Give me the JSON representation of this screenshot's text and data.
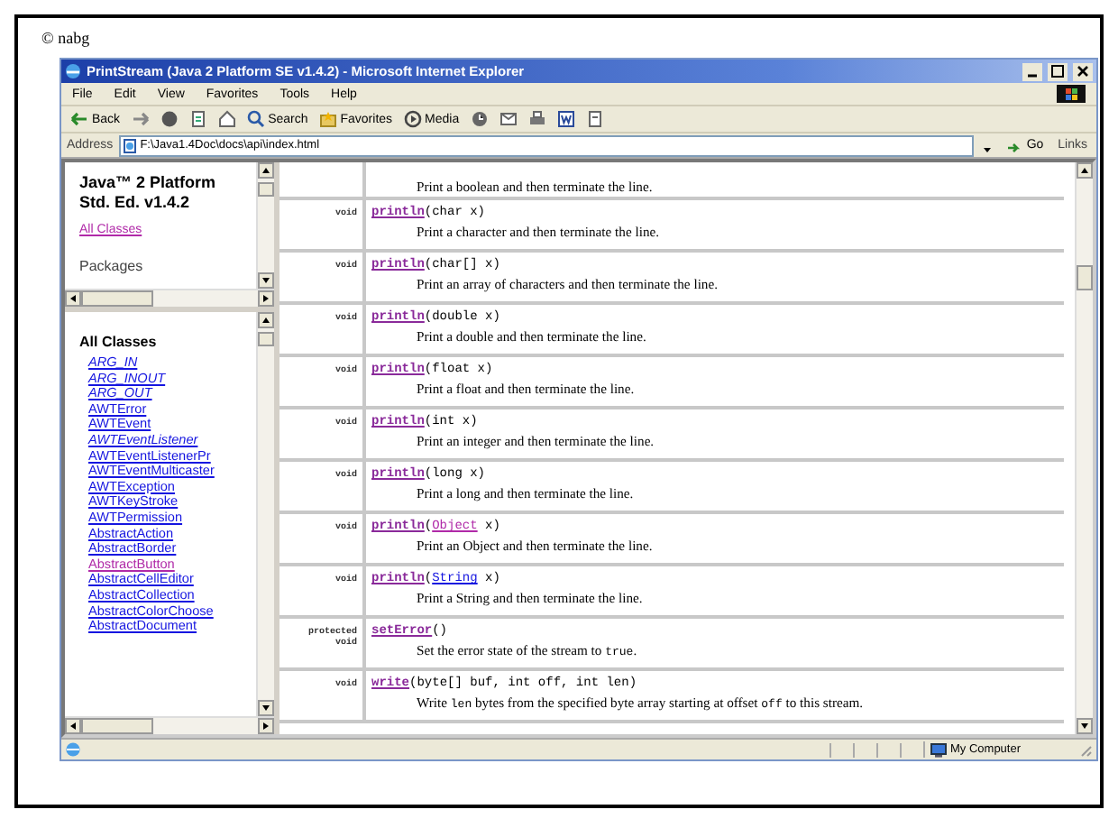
{
  "credit": "© nabg",
  "window": {
    "title": "PrintStream (Java 2 Platform SE v1.4.2) - Microsoft Internet Explorer"
  },
  "menu": [
    "File",
    "Edit",
    "View",
    "Favorites",
    "Tools",
    "Help"
  ],
  "toolbar": [
    {
      "kind": "back",
      "label": "Back"
    },
    {
      "kind": "forward"
    },
    {
      "kind": "stop"
    },
    {
      "kind": "refresh"
    },
    {
      "kind": "home"
    },
    {
      "kind": "search",
      "label": "Search"
    },
    {
      "kind": "favorites",
      "label": "Favorites"
    },
    {
      "kind": "media",
      "label": "Media"
    },
    {
      "kind": "history"
    },
    {
      "kind": "mail"
    },
    {
      "kind": "print"
    },
    {
      "kind": "edit"
    },
    {
      "kind": "discuss"
    }
  ],
  "address": {
    "label": "Address",
    "value": "F:\\Java1.4Doc\\docs\\api\\index.html",
    "go": "Go",
    "links": "Links"
  },
  "packages_frame": {
    "title_lines": [
      "Java™ 2 Platform",
      "Std. Ed. v1.4.2"
    ],
    "link": {
      "text": "All Classes",
      "visited": true
    },
    "heading": "Packages"
  },
  "classes_frame": {
    "heading": "All Classes",
    "classes": [
      {
        "name": "ARG_IN",
        "italic": true,
        "visited": false
      },
      {
        "name": "ARG_INOUT",
        "italic": true,
        "visited": false
      },
      {
        "name": "ARG_OUT",
        "italic": true,
        "visited": false
      },
      {
        "name": "AWTError",
        "italic": false,
        "visited": false
      },
      {
        "name": "AWTEvent",
        "italic": false,
        "visited": false
      },
      {
        "name": "AWTEventListener",
        "italic": true,
        "visited": false
      },
      {
        "name": "AWTEventListenerPr",
        "italic": false,
        "visited": false
      },
      {
        "name": "AWTEventMulticaster",
        "italic": false,
        "visited": false
      },
      {
        "name": "AWTException",
        "italic": false,
        "visited": false
      },
      {
        "name": "AWTKeyStroke",
        "italic": false,
        "visited": false
      },
      {
        "name": "AWTPermission",
        "italic": false,
        "visited": false
      },
      {
        "name": "AbstractAction",
        "italic": false,
        "visited": false
      },
      {
        "name": "AbstractBorder",
        "italic": false,
        "visited": false
      },
      {
        "name": "AbstractButton",
        "italic": false,
        "visited": true
      },
      {
        "name": "AbstractCellEditor",
        "italic": false,
        "visited": false
      },
      {
        "name": "AbstractCollection",
        "italic": false,
        "visited": false
      },
      {
        "name": "AbstractColorChoose",
        "italic": false,
        "visited": false
      },
      {
        "name": "AbstractDocument",
        "italic": false,
        "visited": false
      }
    ]
  },
  "methods": [
    {
      "description": [
        {
          "text": "Print a boolean and then terminate the line."
        }
      ]
    },
    {
      "modifier": [
        "void"
      ],
      "name": "println",
      "params": [
        {
          "text": "(char x)"
        }
      ],
      "description": [
        {
          "text": "Print a character and then terminate the line."
        }
      ]
    },
    {
      "modifier": [
        "void"
      ],
      "name": "println",
      "params": [
        {
          "text": "(char[] x)"
        }
      ],
      "description": [
        {
          "text": "Print an array of characters and then terminate the line."
        }
      ]
    },
    {
      "modifier": [
        "void"
      ],
      "name": "println",
      "params": [
        {
          "text": "(double x)"
        }
      ],
      "description": [
        {
          "text": "Print a double and then terminate the line."
        }
      ]
    },
    {
      "modifier": [
        "void"
      ],
      "name": "println",
      "params": [
        {
          "text": "(float x)"
        }
      ],
      "description": [
        {
          "text": "Print a float and then terminate the line."
        }
      ]
    },
    {
      "modifier": [
        "void"
      ],
      "name": "println",
      "params": [
        {
          "text": "(int x)"
        }
      ],
      "description": [
        {
          "text": "Print an integer and then terminate the line."
        }
      ]
    },
    {
      "modifier": [
        "void"
      ],
      "name": "println",
      "params": [
        {
          "text": "(long x)"
        }
      ],
      "description": [
        {
          "text": "Print a long and then terminate the line."
        }
      ]
    },
    {
      "modifier": [
        "void"
      ],
      "name": "println",
      "params": [
        {
          "text": "("
        },
        {
          "text": "Object",
          "link": true,
          "visited": true
        },
        {
          "text": " x)"
        }
      ],
      "description": [
        {
          "text": "Print an Object and then terminate the line."
        }
      ]
    },
    {
      "modifier": [
        "void"
      ],
      "name": "println",
      "params": [
        {
          "text": "("
        },
        {
          "text": "String",
          "link": true,
          "visited": false
        },
        {
          "text": " x)"
        }
      ],
      "description": [
        {
          "text": "Print a String and then terminate the line."
        }
      ]
    },
    {
      "modifier": [
        "protected",
        "void"
      ],
      "name": "setError",
      "params": [
        {
          "text": "()"
        }
      ],
      "description": [
        {
          "text": "Set the error state of the stream to "
        },
        {
          "text": "true",
          "code": true
        },
        {
          "text": "."
        }
      ]
    },
    {
      "modifier": [
        "void"
      ],
      "name": "write",
      "params": [
        {
          "text": "(byte[] buf, int off, int len)"
        }
      ],
      "description": [
        {
          "text": "Write "
        },
        {
          "text": "len",
          "code": true
        },
        {
          "text": " bytes from the specified byte array starting at offset "
        },
        {
          "text": "off",
          "code": true
        },
        {
          "text": " to this stream."
        }
      ]
    }
  ],
  "status_bar": {
    "zone": "My Computer"
  }
}
